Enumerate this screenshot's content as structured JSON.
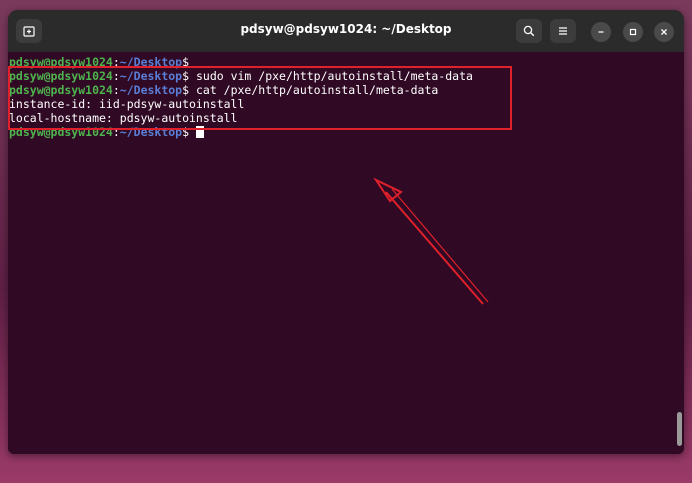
{
  "window": {
    "title": "pdsyw@pdsyw1024: ~/Desktop"
  },
  "terminal": {
    "lines": [
      {
        "user": "pdsyw@pdsyw1024",
        "sep": ":",
        "path": "~/Desktop",
        "dollar": "$",
        "command": ""
      },
      {
        "user": "pdsyw@pdsyw1024",
        "sep": ":",
        "path": "~/Desktop",
        "dollar": "$",
        "command": " sudo vim /pxe/http/autoinstall/meta-data"
      },
      {
        "user": "pdsyw@pdsyw1024",
        "sep": ":",
        "path": "~/Desktop",
        "dollar": "$",
        "command": " cat /pxe/http/autoinstall/meta-data"
      },
      {
        "output": "instance-id: iid-pdsyw-autoinstall"
      },
      {
        "output": "local-hostname: pdsyw-autoinstall"
      },
      {
        "user": "pdsyw@pdsyw1024",
        "sep": ":",
        "path": "~/Desktop",
        "dollar": "$",
        "command": " "
      }
    ]
  },
  "icons": {
    "new_tab": "new-tab-icon",
    "search": "search-icon",
    "menu": "hamburger-menu-icon",
    "minimize": "minimize-icon",
    "maximize": "maximize-icon",
    "close": "close-icon"
  },
  "colors": {
    "terminal_bg": "#300a24",
    "prompt_user": "#4eb44e",
    "prompt_path": "#5a7dd6",
    "annotation_red": "#e0202a"
  }
}
